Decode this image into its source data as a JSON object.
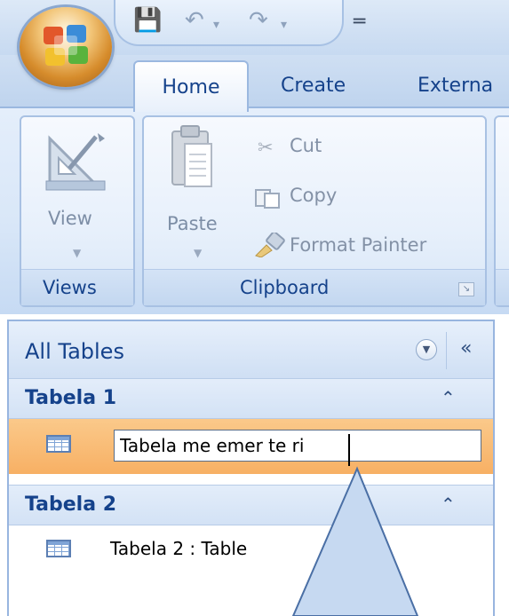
{
  "quick_access": {
    "save_icon": "save-icon",
    "undo_icon": "undo-icon",
    "redo_icon": "redo-icon",
    "customize_icon": "customize-qat-icon"
  },
  "tabs": [
    "Home",
    "Create",
    "Externa"
  ],
  "ribbon": {
    "views_group": {
      "view_label": "View",
      "group_label": "Views"
    },
    "clipboard_group": {
      "paste_label": "Paste",
      "cut_label": "Cut",
      "copy_label": "Copy",
      "format_painter_label": "Format Painter",
      "group_label": "Clipboard"
    }
  },
  "nav_pane": {
    "title": "All Tables",
    "groups": [
      {
        "title": "Tabela 1",
        "items": [
          {
            "value": "Tabela me emer te ri",
            "editing": true
          }
        ]
      },
      {
        "title": "Tabela 2",
        "items": [
          {
            "label": "Tabela 2 : Table"
          }
        ]
      }
    ]
  },
  "colors": {
    "accent": "#15428b",
    "selection": "#f7b064",
    "ribbon_bg": "#dbe8f8",
    "callout_fill": "#c6d9f1",
    "callout_stroke": "#4a6fa5"
  }
}
